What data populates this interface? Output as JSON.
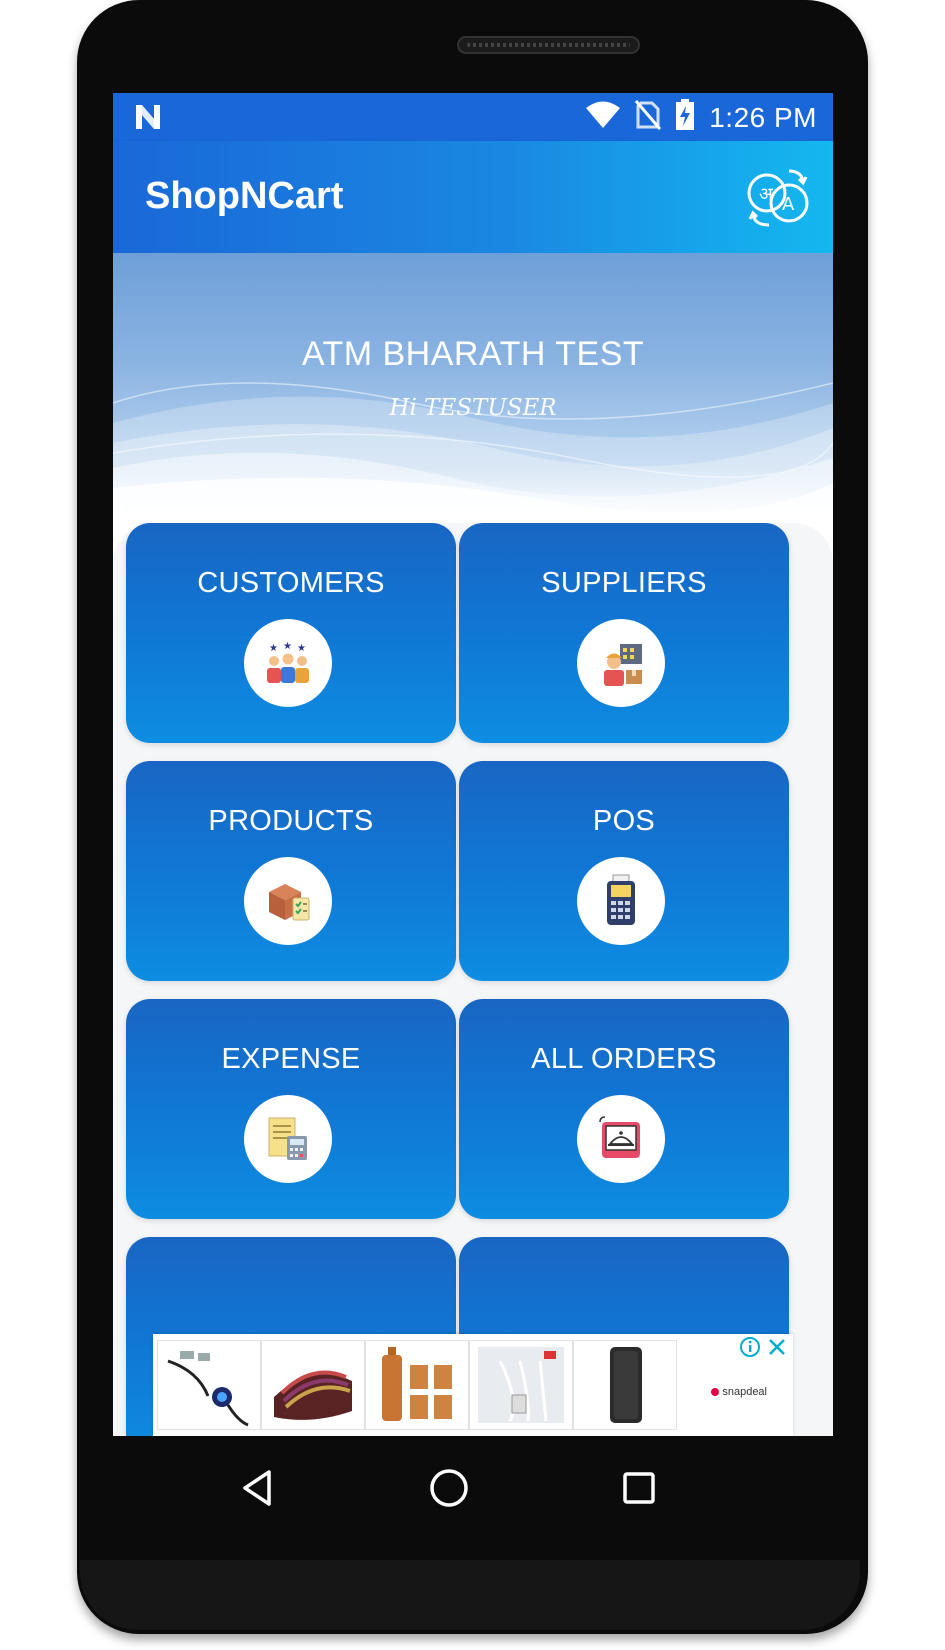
{
  "status_bar": {
    "time": "1:26 PM",
    "icons": [
      "n-notification-icon",
      "wifi-icon",
      "no-sim-icon",
      "battery-charging-icon"
    ]
  },
  "app_bar": {
    "title": "ShopNCart",
    "action_icon": "translate-icon"
  },
  "header": {
    "company_name": "ATM BHARATH TEST",
    "greeting": "Hi TESTUSER"
  },
  "tiles": [
    {
      "label": "CUSTOMERS",
      "icon": "customers-icon"
    },
    {
      "label": "SUPPLIERS",
      "icon": "supplier-icon"
    },
    {
      "label": "PRODUCTS",
      "icon": "box-checklist-icon"
    },
    {
      "label": "POS",
      "icon": "pos-terminal-icon"
    },
    {
      "label": "EXPENSE",
      "icon": "expense-calculator-icon"
    },
    {
      "label": "ALL ORDERS",
      "icon": "orders-cloche-icon"
    }
  ],
  "ad": {
    "brand": "snapdeal",
    "products": [
      "magnetic-cable",
      "card-wallet",
      "copper-bottle-set",
      "usb-cables",
      "power-bank"
    ]
  },
  "nav_bar": {
    "buttons": [
      "back-icon",
      "home-icon",
      "recents-icon"
    ]
  },
  "colors": {
    "status_bar": "#1a67d9",
    "app_bar_start": "#1a68d8",
    "app_bar_end": "#13b8ef",
    "tile_top": "#1966c3",
    "tile_bottom": "#0e8de2"
  }
}
